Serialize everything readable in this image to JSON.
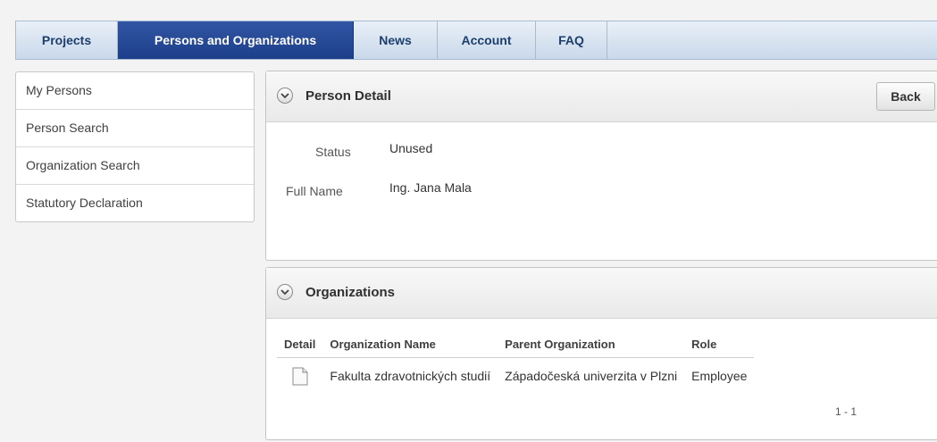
{
  "tabs": [
    {
      "label": "Projects"
    },
    {
      "label": "Persons and Organizations"
    },
    {
      "label": "News"
    },
    {
      "label": "Account"
    },
    {
      "label": "FAQ"
    }
  ],
  "sidebar": {
    "items": [
      {
        "label": "My Persons"
      },
      {
        "label": "Person Search"
      },
      {
        "label": "Organization Search"
      },
      {
        "label": "Statutory Declaration"
      }
    ]
  },
  "person_detail": {
    "title": "Person Detail",
    "back_label": "Back",
    "status_label": "Status",
    "status_value": "Unused",
    "fullname_label": "Full Name",
    "fullname_value": "Ing. Jana Mala"
  },
  "organizations": {
    "title": "Organizations",
    "columns": [
      "Detail",
      "Organization Name",
      "Parent Organization",
      "Role"
    ],
    "rows": [
      {
        "name": "Fakulta zdravotnických studií",
        "parent": "Západočeská univerzita v Plzni",
        "role": "Employee"
      }
    ],
    "pagination": "1 - 1"
  },
  "icons": {
    "collapse": "chevron-down-circle-icon",
    "detail": "document-icon"
  }
}
